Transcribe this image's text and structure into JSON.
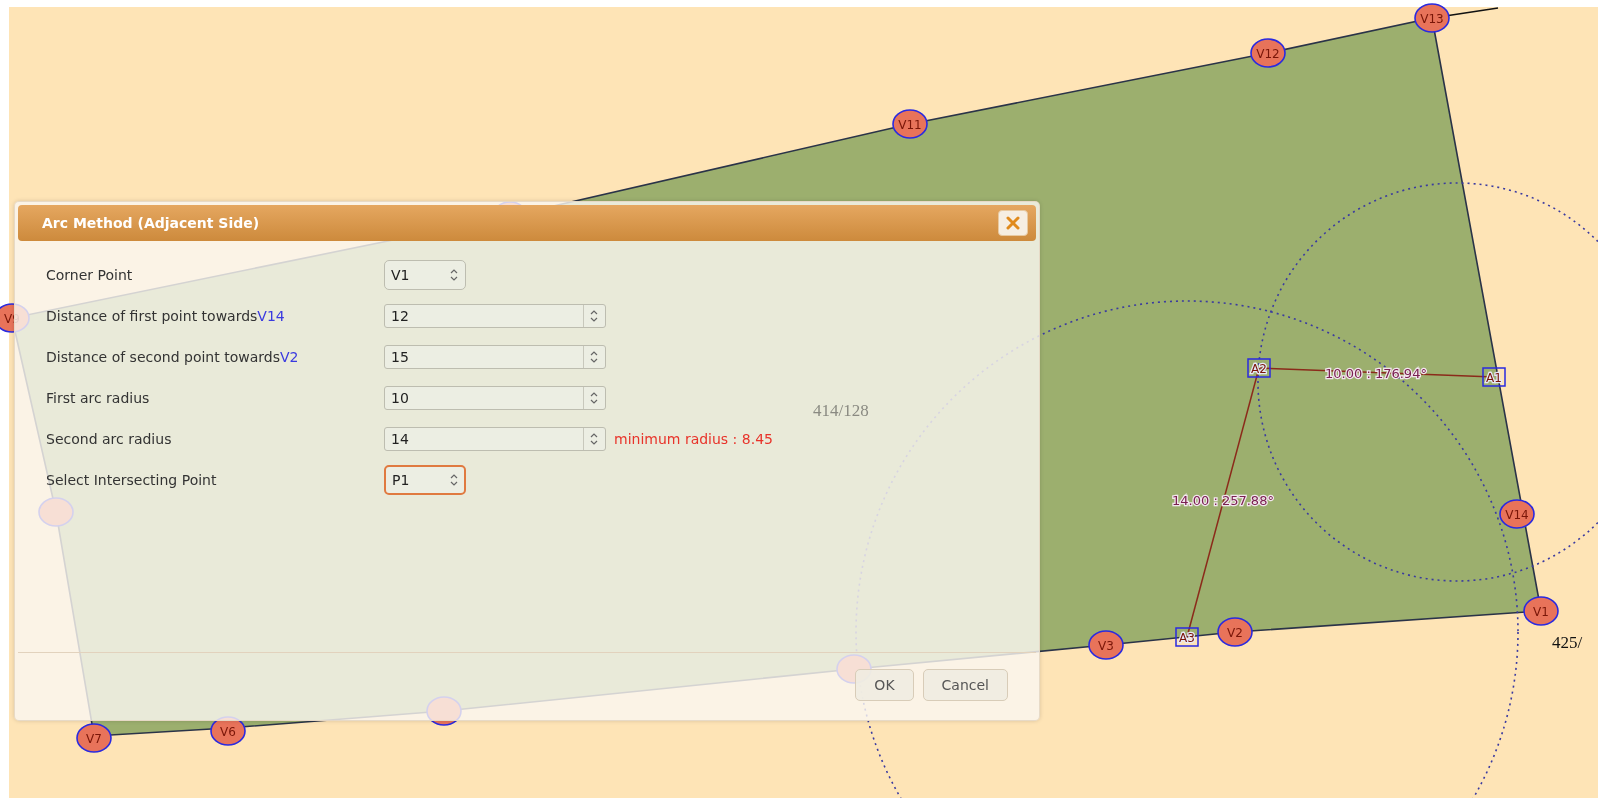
{
  "canvas": {
    "vertices": [
      {
        "kind": "labeled",
        "label": "V13"
      },
      {
        "kind": "labeled",
        "label": "V12"
      },
      {
        "kind": "labeled",
        "label": "V11"
      },
      {
        "kind": "dot"
      },
      {
        "kind": "labeled",
        "label": "V9"
      },
      {
        "kind": "dot"
      },
      {
        "kind": "labeled",
        "label": "V7"
      },
      {
        "kind": "labeled",
        "label": "V6"
      },
      {
        "kind": "dot"
      },
      {
        "kind": "dot"
      },
      {
        "kind": "labeled",
        "label": "V3"
      },
      {
        "kind": "labeled",
        "label": "V2"
      },
      {
        "kind": "labeled",
        "label": "V1"
      },
      {
        "kind": "labeled",
        "label": "V14"
      }
    ],
    "points": [
      {
        "label": "A1"
      },
      {
        "label": "A2"
      },
      {
        "label": "A3"
      }
    ],
    "measurements": [
      {
        "text": "10.00 : 176.94°"
      },
      {
        "text": "14.00 : 257.88°"
      }
    ],
    "coordinates": [
      {
        "text": "414/128"
      },
      {
        "text": "425/"
      }
    ]
  },
  "dialog": {
    "title": "Arc Method (Adjacent Side)",
    "fields": [
      {
        "label": "Corner Point",
        "kind": "spinbox",
        "value": "V1",
        "focused": false
      },
      {
        "label": "Distance of first point towards",
        "target": "V14",
        "kind": "number",
        "value": "12",
        "focused": false
      },
      {
        "label": "Distance of second point towards",
        "target": "V2",
        "kind": "number",
        "value": "15",
        "focused": false
      },
      {
        "label": "First arc radius",
        "kind": "number",
        "value": "10",
        "focused": false
      },
      {
        "label": "Second arc radius",
        "kind": "number",
        "value": "14",
        "focused": false,
        "message": "minimum radius : 8.45"
      },
      {
        "label": "Select Intersecting Point",
        "kind": "spinbox",
        "value": "P1",
        "focused": true
      }
    ],
    "buttons": [
      {
        "label": "OK"
      },
      {
        "label": "Cancel"
      }
    ]
  }
}
